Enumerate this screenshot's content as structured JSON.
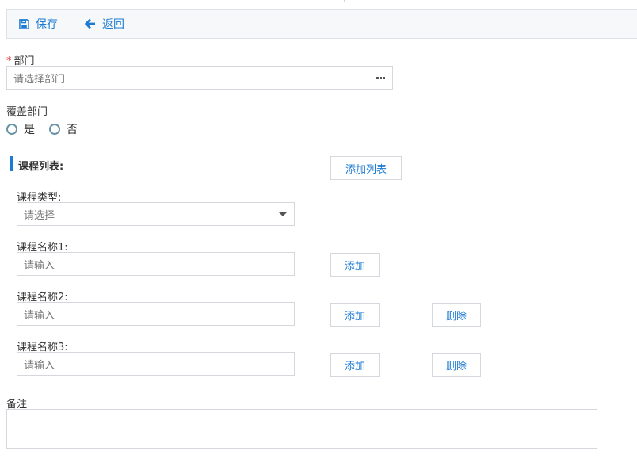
{
  "toolbar": {
    "save_label": "保存",
    "back_label": "返回"
  },
  "form": {
    "department": {
      "required_mark": "*",
      "label": "部门",
      "placeholder": "请选择部门"
    },
    "cover_department": {
      "label": "覆盖部门",
      "options": [
        "是",
        "否"
      ]
    },
    "course_list": {
      "title": "课程列表:",
      "add_list_label": "添加列表",
      "type_label": "课程类型:",
      "type_placeholder": "请选择",
      "courses": [
        {
          "label": "课程名称1:",
          "placeholder": "请输入",
          "add_label": "添加"
        },
        {
          "label": "课程名称2:",
          "placeholder": "请输入",
          "add_label": "添加",
          "delete_label": "删除"
        },
        {
          "label": "课程名称3:",
          "placeholder": "请输入",
          "add_label": "添加",
          "delete_label": "删除"
        }
      ]
    },
    "remark": {
      "label": "备注"
    }
  },
  "colors": {
    "accent": "#1c7bd3",
    "required": "#e23c3c",
    "radio_border": "#6a93a6",
    "border": "#d4d8dd"
  }
}
